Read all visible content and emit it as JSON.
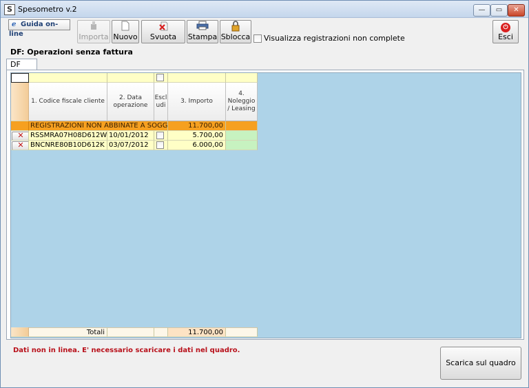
{
  "window": {
    "title": "Spesometro v.2",
    "icon_letter": "S",
    "minimize_glyph": "—",
    "maximize_glyph": "▭",
    "close_glyph": "✕"
  },
  "toolbar": {
    "guide_label": "Guida on-line",
    "import_label": "Importa",
    "new_label": "Nuovo",
    "clear_label": "Svuota",
    "print_label": "Stampa",
    "unlock_label": "Sblocca",
    "show_incomplete_label": "Visualizza registrazioni non complete",
    "show_incomplete_checked": false,
    "exit_label": "Esci",
    "icons": {
      "import": "import-icon",
      "new": "new-document-icon",
      "clear": "red-x-icon",
      "print": "printer-icon",
      "unlock": "padlock-icon",
      "exit": "power-icon",
      "guide": "browser-icon"
    }
  },
  "section_title": "DF: Operazioni senza fattura",
  "tabs": [
    {
      "label": "DF",
      "active": true
    }
  ],
  "table": {
    "columns": [
      {
        "label": "1. Codice fiscale cliente"
      },
      {
        "label": "2. Data operazione"
      },
      {
        "label": "Escl udi"
      },
      {
        "label": "3. Importo"
      },
      {
        "label": "4. Noleggio / Leasing"
      }
    ],
    "group_row": {
      "label": "REGISTRAZIONI NON ABBINATE A SOGGET",
      "amount": "11.700,00"
    },
    "rows": [
      {
        "codice_fiscale": "RSSMRA07H08D612W",
        "data": "10/01/2012",
        "escludi": false,
        "importo": "5.700,00",
        "noleggio": ""
      },
      {
        "codice_fiscale": "BNCNRE80B10D612K",
        "data": "03/07/2012",
        "escludi": false,
        "importo": "6.000,00",
        "noleggio": ""
      }
    ],
    "delete_glyph": "✕",
    "totals_label": "Totali",
    "totals_amount": "11.700,00"
  },
  "status_message": "Dati non in linea. E' necessario scaricare i dati nel quadro.",
  "download_button_label": "Scarica sul quadro",
  "colors": {
    "group_row": "#f6a020",
    "data_row": "#ffffc6",
    "grid_background": "#aed3e8",
    "status_text": "#b8101a",
    "leasing_cell": "#c7f2c0"
  }
}
